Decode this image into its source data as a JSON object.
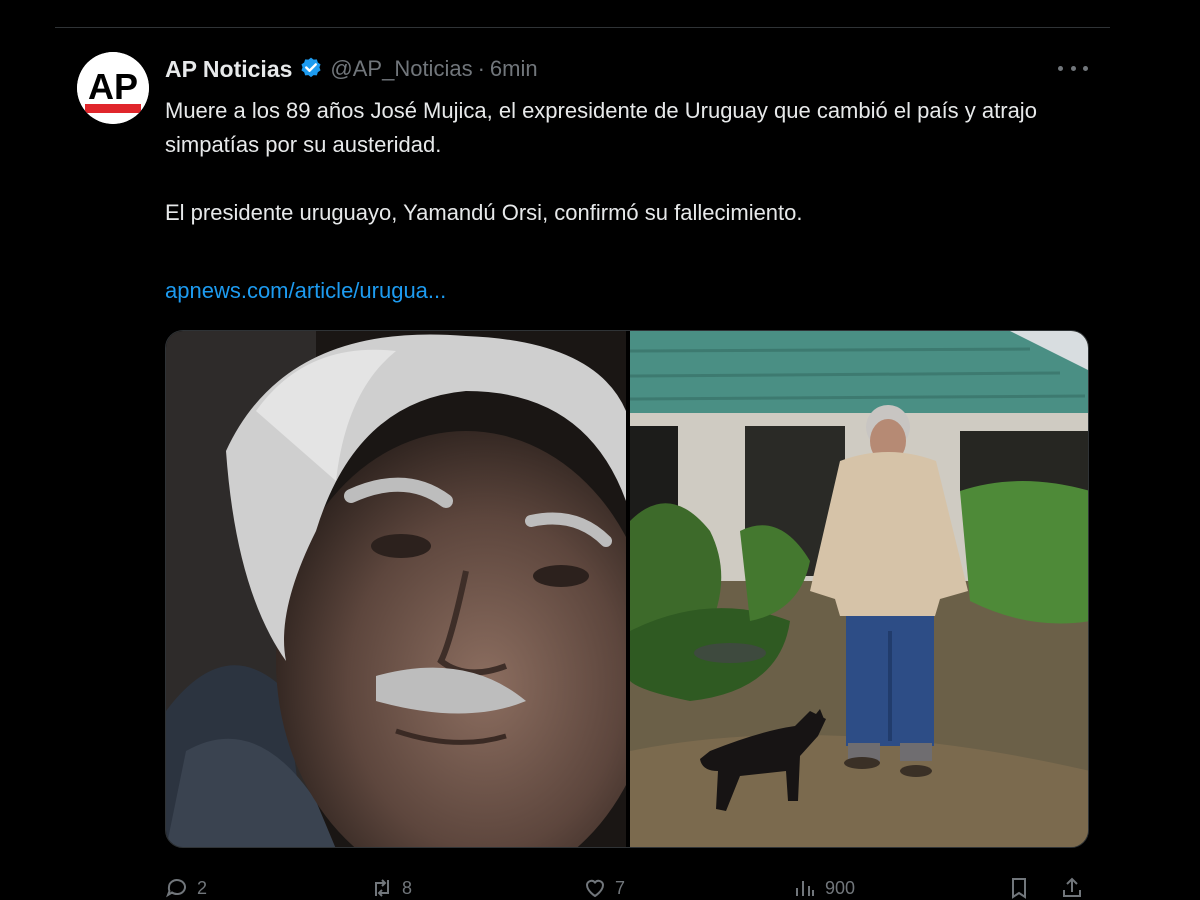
{
  "tweet": {
    "author": {
      "avatar_text": "AP",
      "display_name": "AP Noticias",
      "verified_icon": "verified-badge-icon",
      "handle": "@AP_Noticias",
      "separator": "·",
      "time": "6min"
    },
    "more_icon": "more-dots-icon",
    "text_lines": [
      "Muere a los 89 años José Mujica, el expresidente de Uruguay que cambió el país y atrajo simpatías por su austeridad.",
      "El presidente uruguayo, Yamandú Orsi, confirmó su fallecimiento."
    ],
    "link": "apnews.com/article/urugua...",
    "media": [
      {
        "icon": "photo-portrait-elderly-man"
      },
      {
        "icon": "photo-man-with-dog-garden"
      }
    ],
    "actions": [
      {
        "icon": "reply-icon",
        "count": "2"
      },
      {
        "icon": "retweet-icon",
        "count": "8"
      },
      {
        "icon": "like-icon",
        "count": "7"
      },
      {
        "icon": "views-icon",
        "count": "900"
      },
      {
        "icon": "bookmark-icon",
        "count": ""
      },
      {
        "icon": "share-icon",
        "count": ""
      }
    ]
  },
  "colors": {
    "background": "#000000",
    "text": "#e7e9ea",
    "muted": "#71767b",
    "link": "#1d9bf0",
    "verified": "#1d9bf0",
    "divider": "#2f3336"
  }
}
